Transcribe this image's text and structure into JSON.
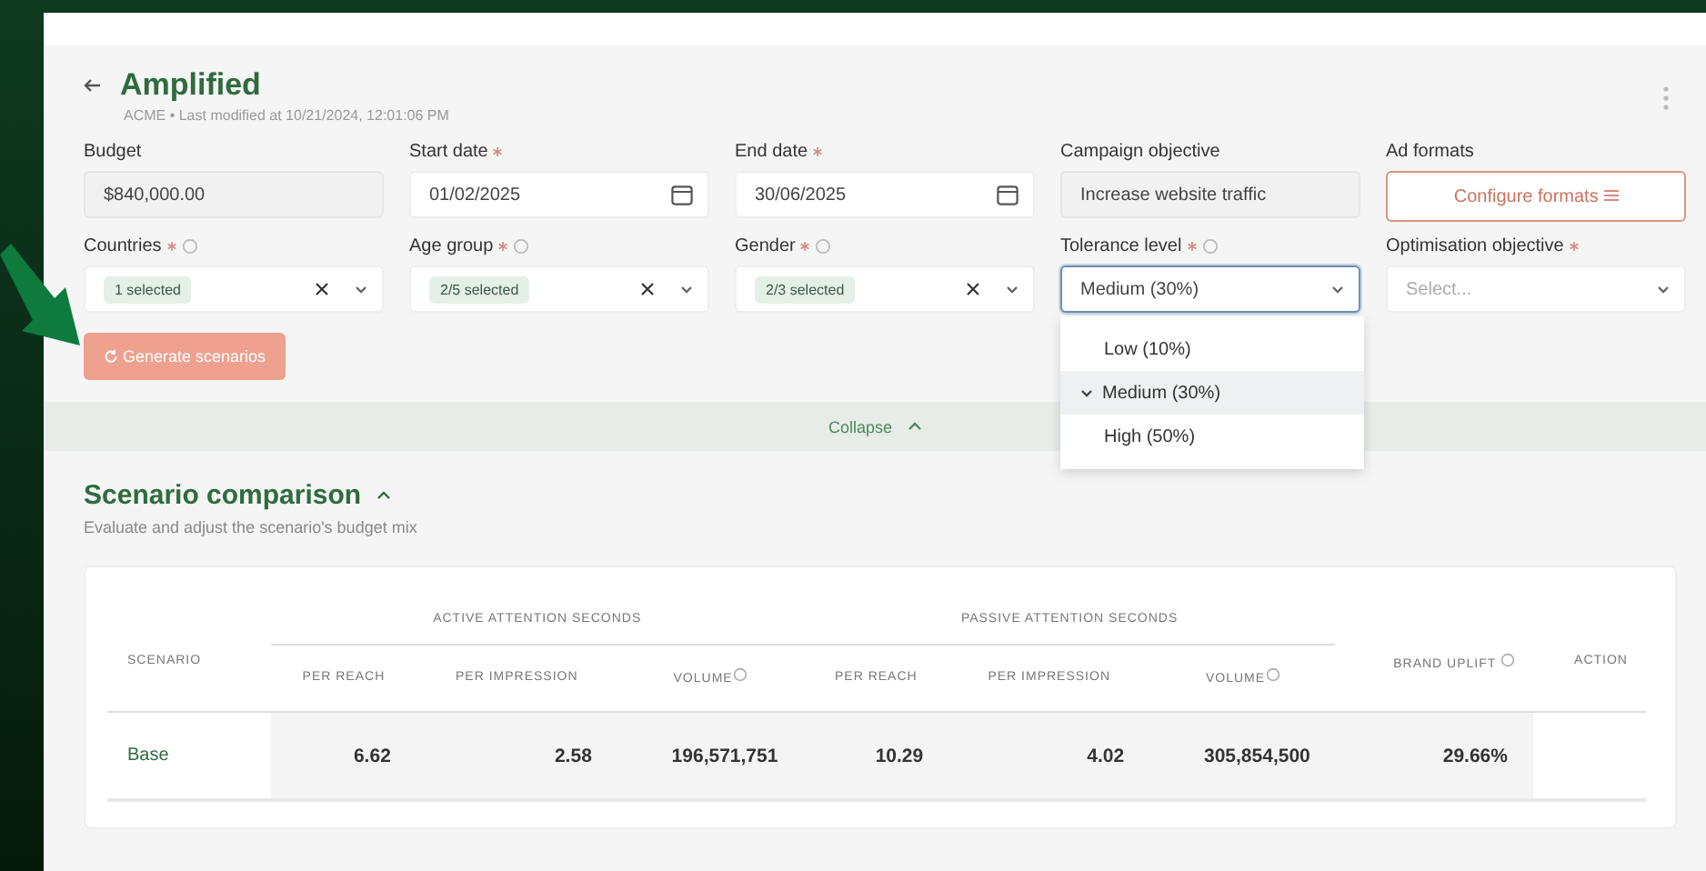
{
  "header": {
    "title": "Amplified",
    "subtitle": "ACME • Last modified at 10/21/2024, 12:01:06 PM"
  },
  "fields": [
    {
      "kind": "text",
      "label": "Budget",
      "required": false,
      "info": false,
      "value": "$840,000.00"
    },
    {
      "kind": "date",
      "label": "Start date",
      "required": true,
      "info": false,
      "value": "01/02/2025"
    },
    {
      "kind": "date",
      "label": "End date",
      "required": true,
      "info": false,
      "value": "30/06/2025"
    },
    {
      "kind": "text",
      "label": "Campaign objective",
      "required": false,
      "info": false,
      "value": "Increase website traffic"
    },
    {
      "kind": "button",
      "label": "Ad formats",
      "required": false,
      "info": false,
      "value": "Configure formats"
    },
    {
      "kind": "multi",
      "label": "Countries",
      "required": true,
      "info": true,
      "value": "1 selected"
    },
    {
      "kind": "multi",
      "label": "Age group",
      "required": true,
      "info": true,
      "value": "2/5 selected"
    },
    {
      "kind": "multi",
      "label": "Gender",
      "required": true,
      "info": true,
      "value": "2/3 selected"
    },
    {
      "kind": "select",
      "label": "Tolerance level",
      "required": true,
      "info": true,
      "value": "Medium (30%)",
      "focused": true
    },
    {
      "kind": "select",
      "label": "Optimisation objective",
      "required": true,
      "info": false,
      "placeholder": "Select...",
      "focused": false
    }
  ],
  "generate_button": {
    "label": "Generate scenarios",
    "disabled": true
  },
  "tolerance_options": [
    {
      "label": "Low (10%)",
      "selected": false
    },
    {
      "label": "Medium (30%)",
      "selected": true
    },
    {
      "label": "High (50%)",
      "selected": false
    }
  ],
  "collapse": {
    "label": "Collapse"
  },
  "section": {
    "title": "Scenario comparison",
    "subtitle": "Evaluate and adjust the scenario's budget mix"
  },
  "table": {
    "scenario_header": "SCENARIO",
    "groups": [
      {
        "label": "ACTIVE ATTENTION SECONDS",
        "columns": [
          {
            "label": "PER REACH",
            "info": false
          },
          {
            "label": "PER IMPRESSION",
            "info": false
          },
          {
            "label": "VOLUME",
            "info": true
          }
        ]
      },
      {
        "label": "PASSIVE ATTENTION SECONDS",
        "columns": [
          {
            "label": "PER REACH",
            "info": false
          },
          {
            "label": "PER IMPRESSION",
            "info": false
          },
          {
            "label": "VOLUME",
            "info": true
          }
        ]
      }
    ],
    "uplift_header": "BRAND UPLIFT",
    "action_header": "ACTION",
    "rows": [
      {
        "scenario": "Base",
        "values": [
          "6.62",
          "2.58",
          "196,571,751",
          "10.29",
          "4.02",
          "305,854,500"
        ],
        "uplift": "29.66%"
      }
    ]
  }
}
